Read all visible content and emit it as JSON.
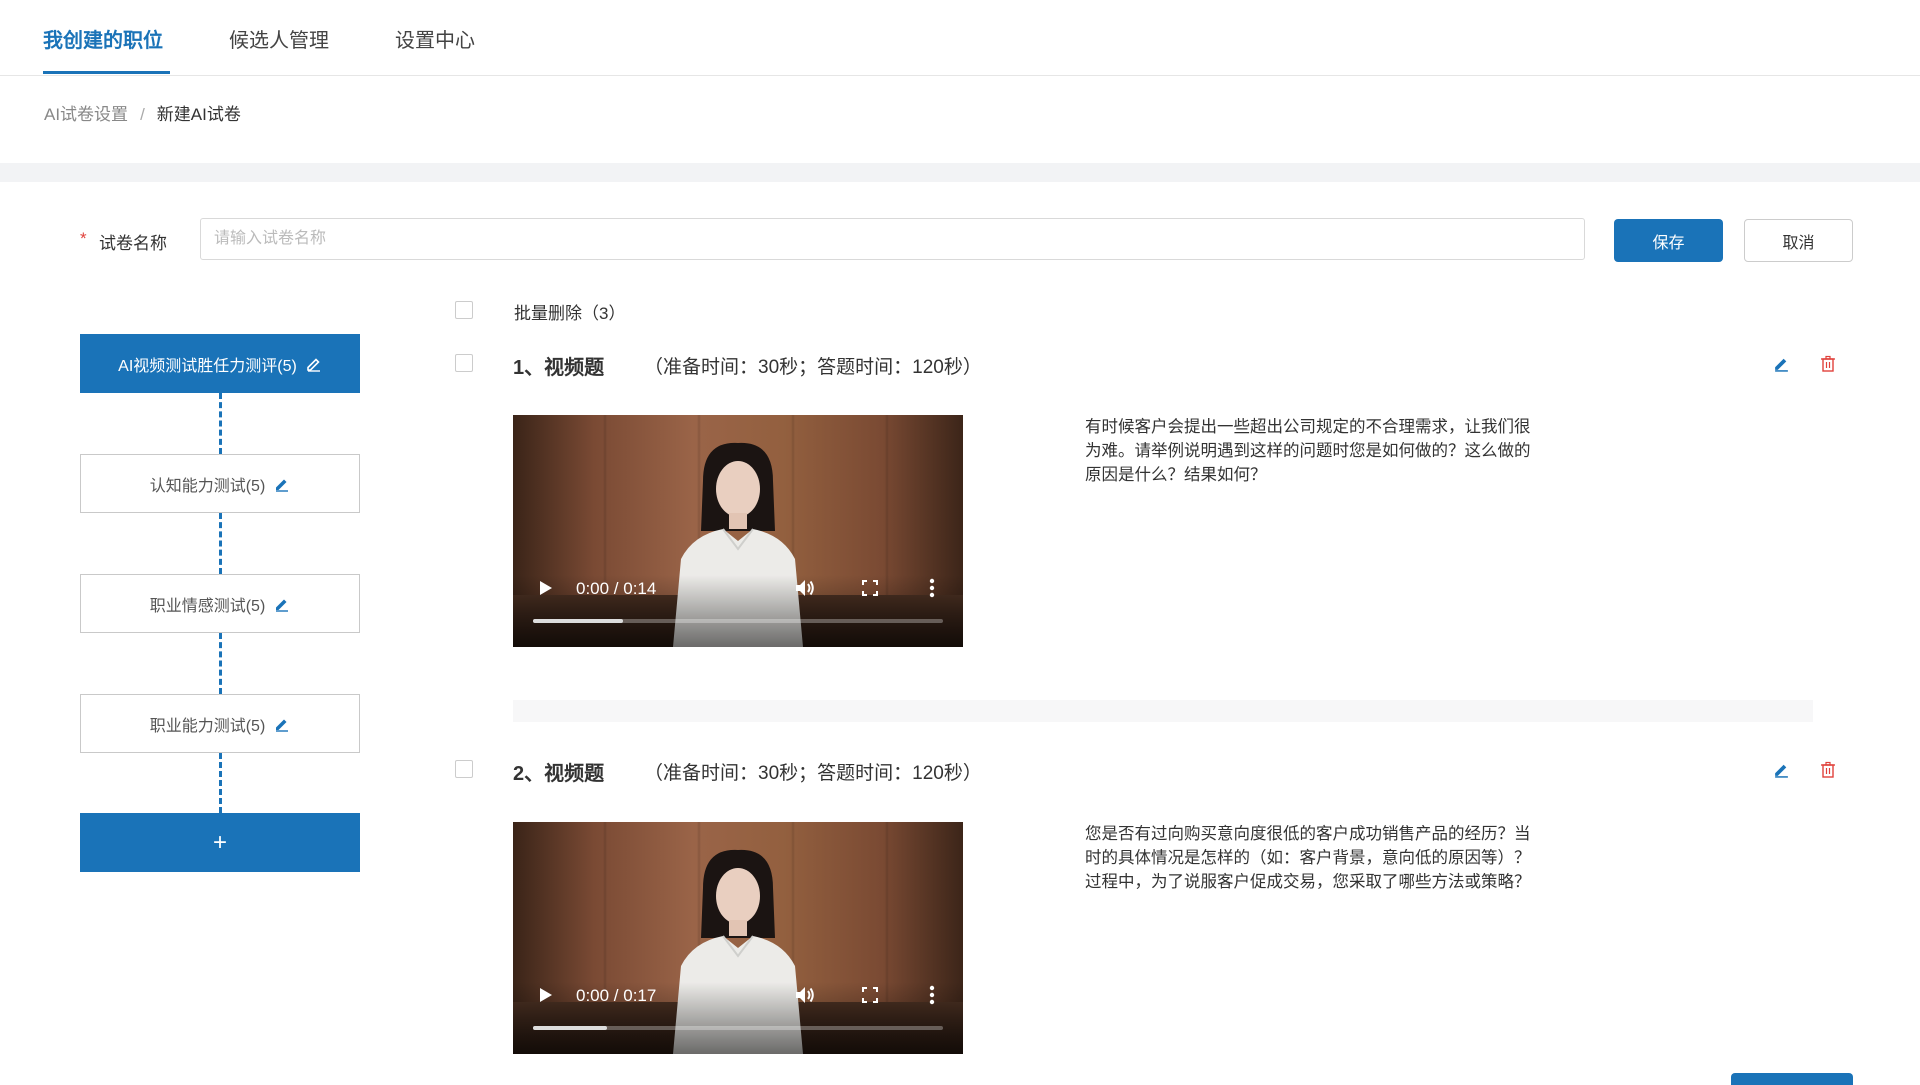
{
  "nav": {
    "tabs": [
      {
        "label": "我创建的职位",
        "active": true
      },
      {
        "label": "候选人管理",
        "active": false
      },
      {
        "label": "设置中心",
        "active": false
      }
    ]
  },
  "breadcrumb": {
    "parent": "AI试卷设置",
    "separator": "/",
    "current": "新建AI试卷"
  },
  "form": {
    "required_mark": "*",
    "name_label": "试卷名称",
    "name_value": "",
    "name_placeholder": "请输入试卷名称",
    "save_label": "保存",
    "cancel_label": "取消"
  },
  "dimensions": {
    "items": [
      {
        "label": "AI视频测试胜任力测评(5)",
        "active": true,
        "icon": "edit-icon"
      },
      {
        "label": "认知能力测试(5)",
        "active": false,
        "icon": "edit-icon"
      },
      {
        "label": "职业情感测试(5)",
        "active": false,
        "icon": "edit-icon"
      },
      {
        "label": "职业能力测试(5)",
        "active": false,
        "icon": "edit-icon"
      }
    ],
    "add_label": "+"
  },
  "batch": {
    "label": "批量删除（3）"
  },
  "questions": [
    {
      "number": "1、视频题",
      "timing": "（准备时间：30秒；答题时间：120秒）",
      "video_time": "0:00 / 0:14",
      "video_progress": 0.22,
      "text": "有时候客户会提出一些超出公司规定的不合理需求，让我们很为难。请举例说明遇到这样的问题时您是如何做的？这么做的原因是什么？结果如何？"
    },
    {
      "number": "2、视频题",
      "timing": "（准备时间：30秒；答题时间：120秒）",
      "video_time": "0:00 / 0:17",
      "video_progress": 0.18,
      "text": "您是否有过向购买意向度很低的客户成功销售产品的经历？当时的具体情况是怎样的（如：客户背景，意向低的原因等）？过程中，为了说服客户促成交易，您采取了哪些方法或策略？"
    }
  ],
  "colors": {
    "primary": "#1a73b8",
    "danger": "#e0413b",
    "border": "#d9d9d9"
  }
}
